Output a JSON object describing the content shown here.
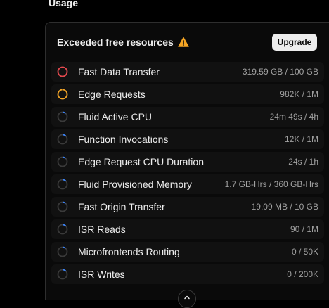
{
  "section": {
    "title": "Usage"
  },
  "card": {
    "title": "Exceeded free resources",
    "warning_icon": "warning-triangle-icon",
    "upgrade_label": "Upgrade"
  },
  "colors": {
    "exceeded": "#e5484d",
    "warning": "#f5a524",
    "normal": "#3b82f6",
    "track": "#3a3a3a"
  },
  "resources": [
    {
      "label": "Fast Data Transfer",
      "value": "319.59 GB / 100 GB",
      "status": "exceeded",
      "progress": 1.0
    },
    {
      "label": "Edge Requests",
      "value": "982K / 1M",
      "status": "warning",
      "progress": 0.982
    },
    {
      "label": "Fluid Active CPU",
      "value": "24m 49s / 4h",
      "status": "normal",
      "progress": 0.1
    },
    {
      "label": "Function Invocations",
      "value": "12K / 1M",
      "status": "normal",
      "progress": 0.012
    },
    {
      "label": "Edge Request CPU Duration",
      "value": "24s / 1h",
      "status": "normal",
      "progress": 0.007
    },
    {
      "label": "Fluid Provisioned Memory",
      "value": "1.7 GB-Hrs / 360 GB-Hrs",
      "status": "normal",
      "progress": 0.005
    },
    {
      "label": "Fast Origin Transfer",
      "value": "19.09 MB / 10 GB",
      "status": "normal",
      "progress": 0.002
    },
    {
      "label": "ISR Reads",
      "value": "90 / 1M",
      "status": "normal",
      "progress": 0.0001
    },
    {
      "label": "Microfrontends Routing",
      "value": "0 / 50K",
      "status": "normal",
      "progress": 0
    },
    {
      "label": "ISR Writes",
      "value": "0 / 200K",
      "status": "normal",
      "progress": 0
    }
  ],
  "collapse_icon": "chevron-up-icon"
}
